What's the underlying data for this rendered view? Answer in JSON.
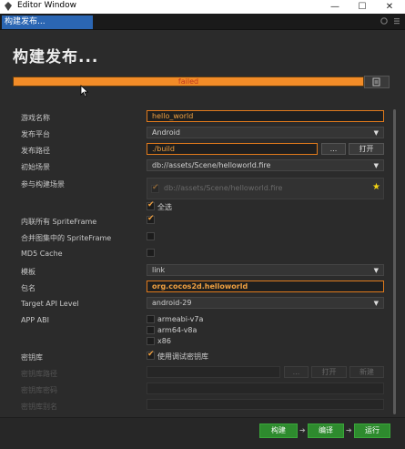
{
  "window": {
    "title": "Editor Window",
    "min": "—",
    "max": "☐",
    "close": "✕"
  },
  "tab": {
    "label": "构建发布..."
  },
  "heading": "构建发布...",
  "progress": {
    "text": "failed",
    "fraction": 1.0
  },
  "fields": {
    "game_name": {
      "label": "游戏名称",
      "value": "hello_world"
    },
    "platform": {
      "label": "发布平台",
      "value": "Android"
    },
    "build_path": {
      "label": "发布路径",
      "value": "./build",
      "browse": "...",
      "open": "打开"
    },
    "start_scene": {
      "label": "初始场景",
      "value": "db://assets/Scene/helloworld.fire"
    },
    "scenes": {
      "label": "参与构建场景",
      "item": "db://assets/Scene/helloworld.fire",
      "select_all": "全选"
    },
    "inline_sprite": {
      "label": "内联所有 SpriteFrame"
    },
    "merge_atlas": {
      "label": "合并图集中的 SpriteFrame"
    },
    "md5": {
      "label": "MD5 Cache"
    },
    "template": {
      "label": "模板",
      "value": "link"
    },
    "package": {
      "label": "包名",
      "value": "org.cocos2d.helloworld"
    },
    "api_level": {
      "label": "Target API Level",
      "value": "android-29"
    },
    "app_abi": {
      "label": "APP ABI",
      "options": [
        "armeabi-v7a",
        "arm64-v8a",
        "x86"
      ]
    },
    "keystore": {
      "label": "密钥库",
      "debug": "使用调试密钥库"
    },
    "keystore_path": {
      "label": "密钥库路径",
      "browse": "...",
      "open": "打开",
      "new": "新建"
    },
    "keystore_password": {
      "label": "密钥库密码"
    },
    "keystore_alias": {
      "label": "密钥库别名"
    }
  },
  "actions": {
    "build": "构建",
    "compile": "编译",
    "run": "运行"
  },
  "colors": {
    "accent": "#f28c28",
    "green": "#2e8b2e",
    "tab": "#2b66b3"
  }
}
